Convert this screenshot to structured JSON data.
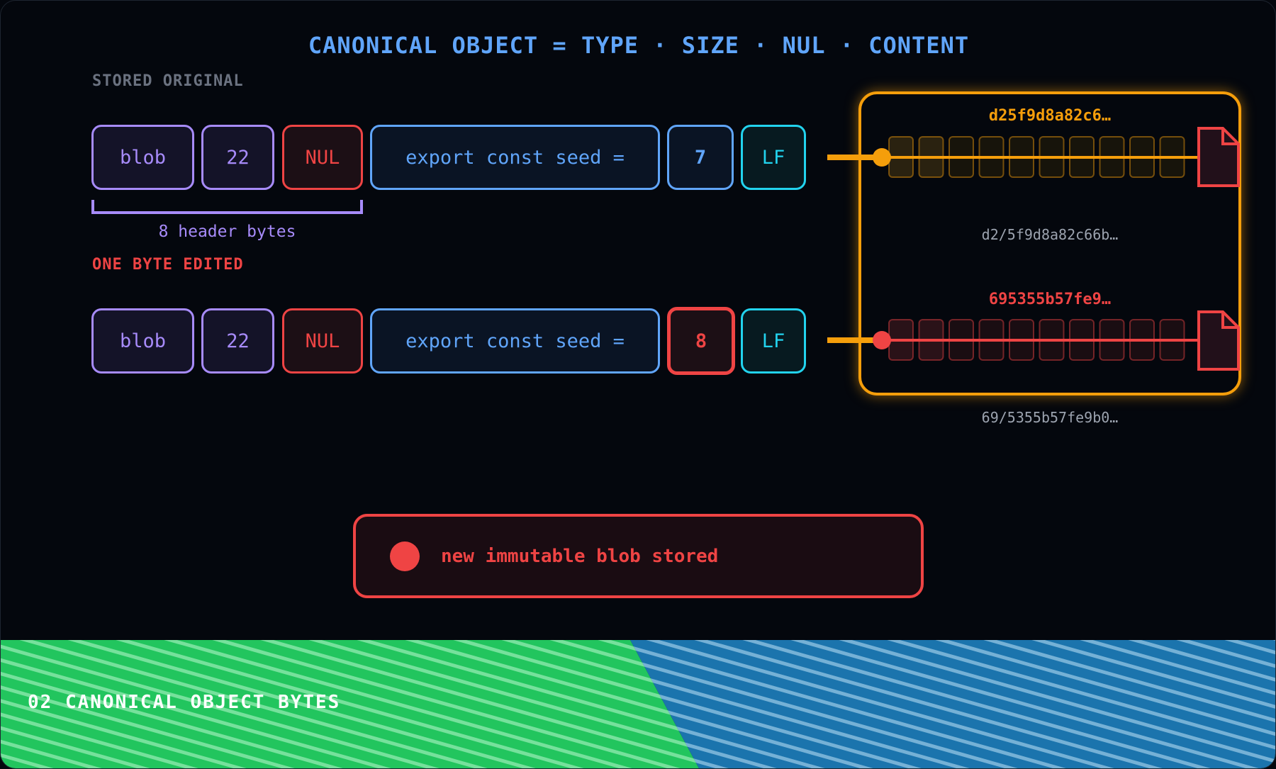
{
  "title": "CANONICAL OBJECT = TYPE · SIZE · NUL · CONTENT",
  "original": {
    "section_label": "STORED ORIGINAL",
    "cells": [
      "blob",
      "22",
      "NUL",
      "export const seed =",
      "7",
      "LF"
    ],
    "brace_label": "8 header bytes",
    "hash": "d25f9d8a82c6…",
    "path": "d2/5f9d8a82c66b…"
  },
  "edited": {
    "section_label": "ONE BYTE EDITED",
    "cells": [
      "blob",
      "22",
      "NUL",
      "export const seed =",
      "8",
      "LF"
    ],
    "hash": "695355b57fe9…",
    "path": "69/5355b57fe9b0…"
  },
  "status": {
    "text": "new immutable blob stored"
  },
  "footer": {
    "label": "02 CANONICAL OBJECT BYTES"
  },
  "colors": {
    "type": "#a78bfa",
    "nul": "#ef4444",
    "content": "#60a5fa",
    "lf": "#22d3ee",
    "store": "#f59e0b",
    "footer_left": "#22c55e",
    "footer_right": "#1b74ad"
  },
  "icons": [
    "object-file-icon",
    "status-dot-icon"
  ]
}
